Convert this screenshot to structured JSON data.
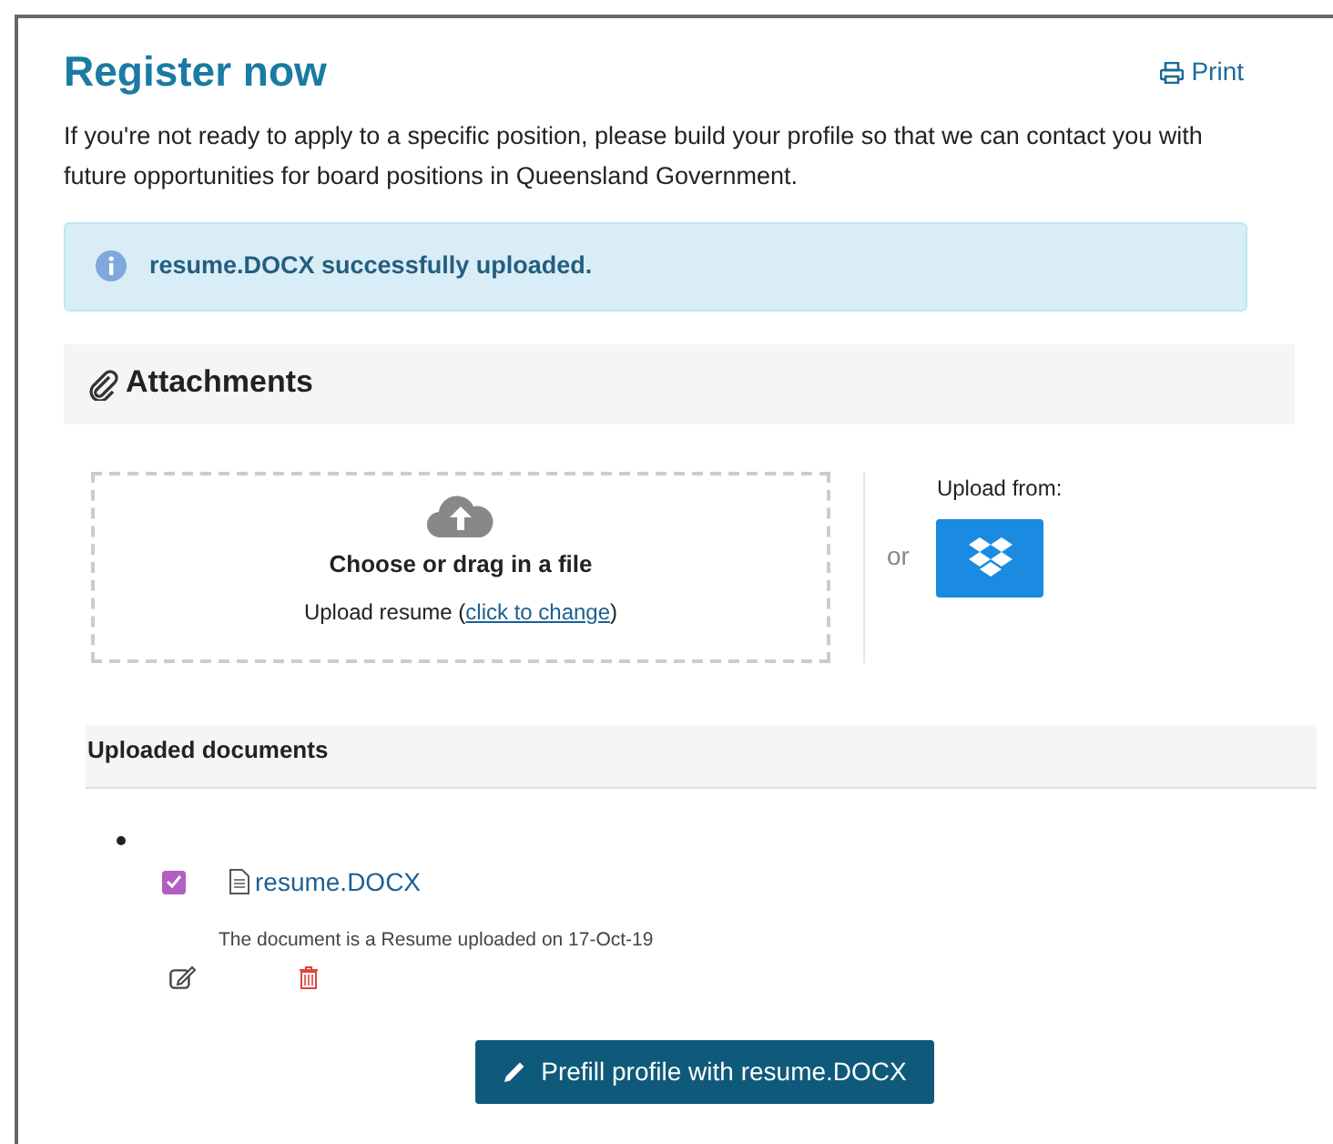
{
  "page": {
    "title": "Register now",
    "print_link": "Print",
    "intro": "If you're not ready to apply to a specific position, please build your profile so that we can contact you with future opportunities for board positions in Queensland Government."
  },
  "alert": {
    "message": "resume.DOCX successfully uploaded."
  },
  "attachments": {
    "heading": "Attachments",
    "dropzone": {
      "title": "Choose or drag in a file",
      "hint_before": "Upload resume (",
      "hint_link": "click to change",
      "hint_after": ")"
    },
    "separator": "or",
    "upload_from": "Upload from:"
  },
  "uploaded": {
    "heading": "Uploaded documents",
    "documents": [
      {
        "name": "resume.DOCX",
        "checked": true,
        "description": "The document is a Resume uploaded on 17-Oct-19"
      }
    ]
  },
  "prefill_button": "Prefill profile with resume.DOCX"
}
